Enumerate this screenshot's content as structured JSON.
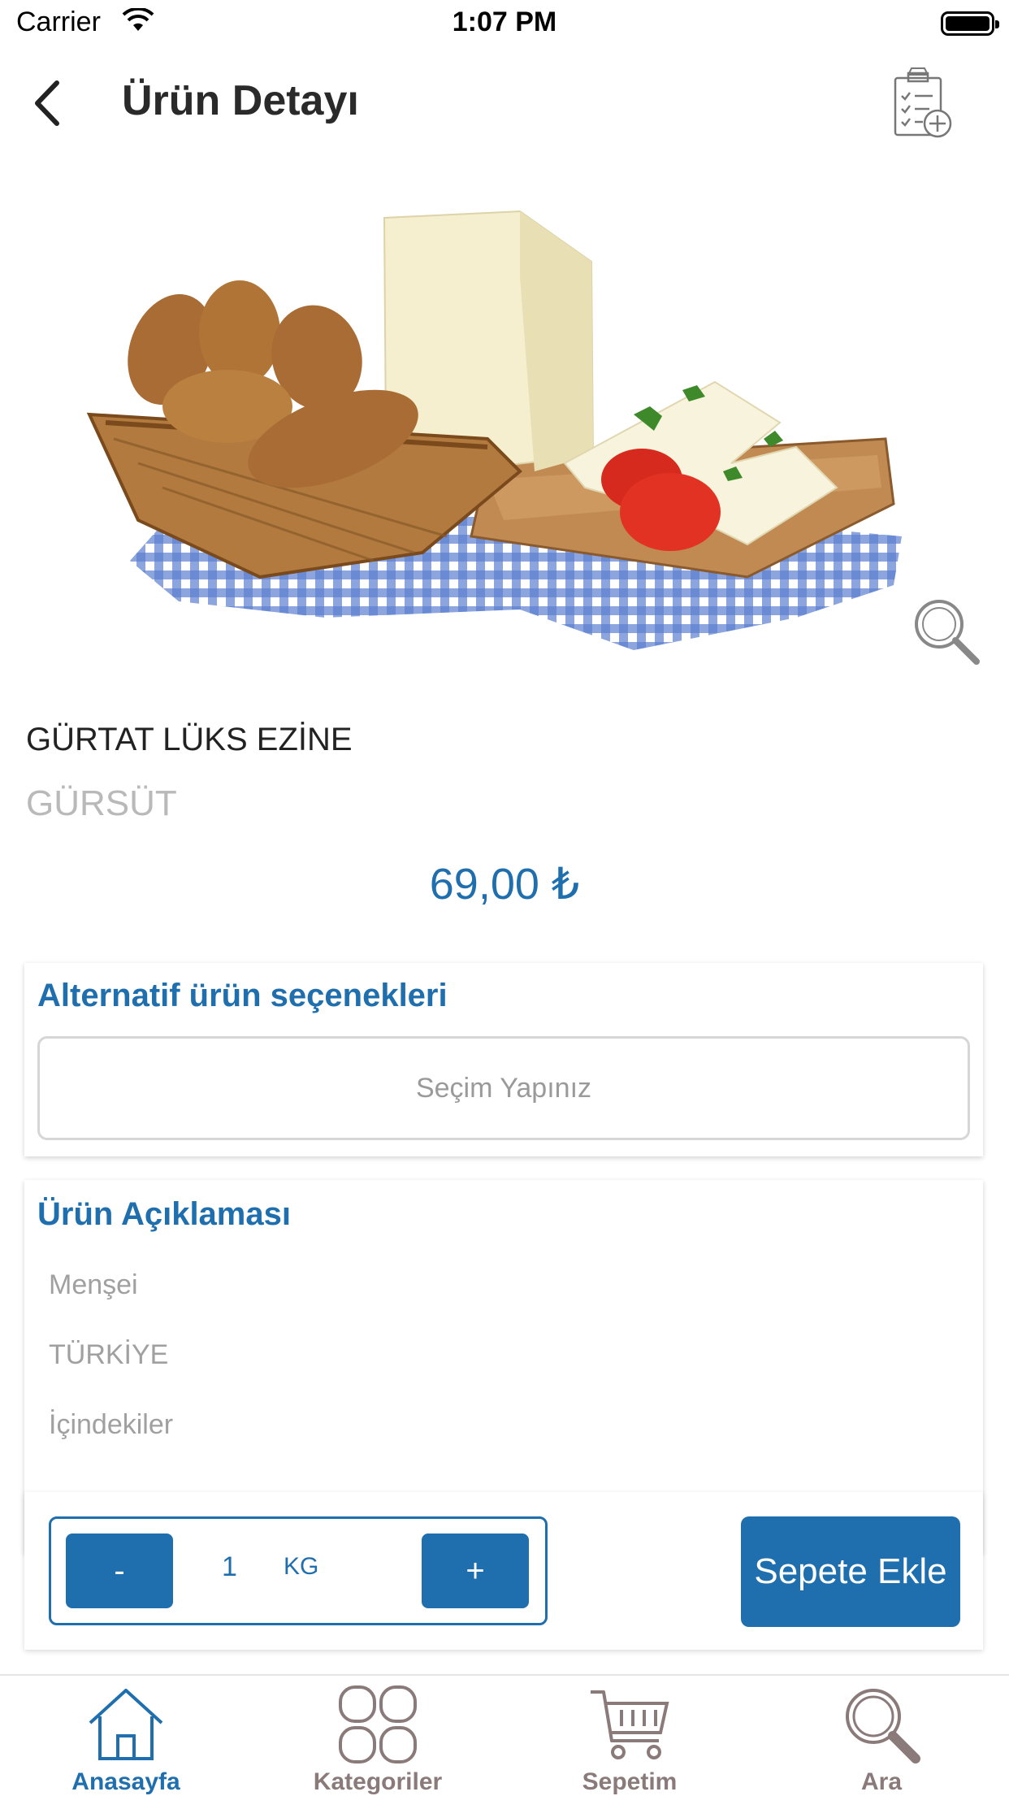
{
  "status_bar": {
    "carrier": "Carrier",
    "time": "1:07 PM"
  },
  "header": {
    "title": "Ürün Detayı",
    "back_icon": "chevron-left-icon",
    "action_icon": "shopping-list-add-icon"
  },
  "product": {
    "name": "GÜRTAT LÜKS EZİNE",
    "brand": "GÜRSÜT",
    "price": "69,00 ₺",
    "image": "cheese-bread-basket-photo"
  },
  "alternatives": {
    "title": "Alternatif ürün seçenekleri",
    "placeholder": "Seçim Yapınız"
  },
  "description": {
    "title": "Ürün Açıklaması",
    "items": [
      "Menşei",
      "TÜRKİYE",
      "İçindekiler"
    ]
  },
  "cart": {
    "minus": "-",
    "plus": "+",
    "quantity": "1",
    "unit": "KG",
    "add_label": "Sepete Ekle"
  },
  "tabs": [
    {
      "label": "Anasayfa",
      "icon": "home-icon",
      "active": true
    },
    {
      "label": "Kategoriler",
      "icon": "grid-icon",
      "active": false
    },
    {
      "label": "Sepetim",
      "icon": "cart-icon",
      "active": false
    },
    {
      "label": "Ara",
      "icon": "search-icon",
      "active": false
    }
  ],
  "colors": {
    "accent": "#1f6fae",
    "muted": "#a0a0a0"
  }
}
